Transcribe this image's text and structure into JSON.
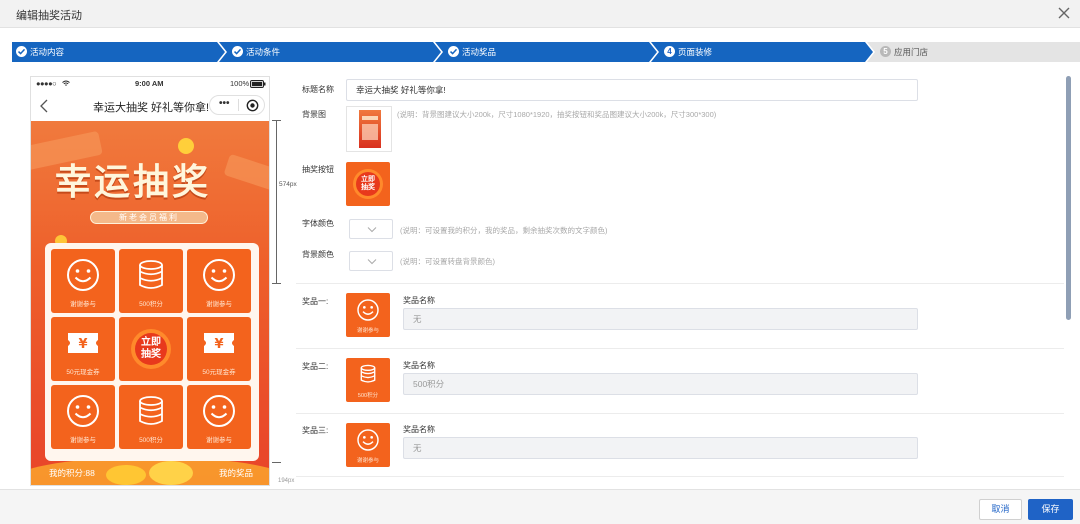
{
  "dialog": {
    "title": "编辑抽奖活动",
    "close_icon": "close-icon"
  },
  "steps": [
    {
      "label": "活动内容",
      "state": "done"
    },
    {
      "label": "活动条件",
      "state": "done"
    },
    {
      "label": "活动奖品",
      "state": "done"
    },
    {
      "label": "页面装修",
      "state": "current",
      "number": "4"
    },
    {
      "label": "应用门店",
      "state": "pending",
      "number": "5"
    }
  ],
  "colors": {
    "primary": "#1f63c6",
    "step_done": "#1565c0",
    "step_pending": "#e4e4e4",
    "prize_orange": "#f3631d",
    "hero_top": "#f07a3d",
    "hero_bottom": "#e8442a"
  },
  "phone": {
    "status": {
      "signal": "●●●●○",
      "time": "9:00 AM",
      "battery": "100%"
    },
    "nav_title": "幸运大抽奖 好礼等你拿!",
    "hero_title": "幸运抽奖",
    "hero_subtitle": "新老会员福利",
    "grid": [
      {
        "label": "谢谢参与",
        "icon": "smile-icon"
      },
      {
        "label": "500积分",
        "icon": "coin-stack-icon"
      },
      {
        "label": "谢谢参与",
        "icon": "smile-icon"
      },
      {
        "label": "50元现金券",
        "icon": "coupon-icon"
      },
      {
        "label": "立即抽奖",
        "icon": "draw-button"
      },
      {
        "label": "50元现金券",
        "icon": "coupon-icon"
      },
      {
        "label": "谢谢参与",
        "icon": "smile-icon"
      },
      {
        "label": "500积分",
        "icon": "coin-stack-icon"
      },
      {
        "label": "谢谢参与",
        "icon": "smile-icon"
      }
    ],
    "draw_button_text": "立即抽奖",
    "draw_button_line1": "立即",
    "draw_button_line2": "抽奖",
    "my_points": "我的积分:88",
    "my_prize": "我的奖品",
    "height_marker": "574px",
    "height_marker_2": "194px"
  },
  "form": {
    "title_label": "标题名称",
    "title_value": "幸运大抽奖 好礼等你拿!",
    "bg_label": "背景图",
    "bg_hint": "(说明：背景图建议大小200k，尺寸1080*1920，抽奖按钮和奖品图建议大小200k，尺寸300*300)",
    "draw_btn_label": "抽奖按钮",
    "draw_btn_thumb_line1": "立即",
    "draw_btn_thumb_line2": "抽奖",
    "font_color_label": "字体颜色",
    "font_color_hint": "(说明：可设置我的积分，我的奖品，剩余抽奖次数的文字颜色)",
    "bg_color_label": "背景颜色",
    "bg_color_hint": "(说明：可设置转盘背景颜色)",
    "prizes": [
      {
        "label": "奖品一:",
        "name_label": "奖品名称",
        "placeholder": "无",
        "thumb_caption": "谢谢参与",
        "icon": "smile-icon"
      },
      {
        "label": "奖品二:",
        "name_label": "奖品名称",
        "placeholder": "500积分",
        "thumb_caption": "500积分",
        "icon": "coin-stack-icon"
      },
      {
        "label": "奖品三:",
        "name_label": "奖品名称",
        "placeholder": "无",
        "thumb_caption": "谢谢参与",
        "icon": "smile-icon"
      }
    ]
  },
  "footer": {
    "cancel": "取消",
    "save": "保存"
  }
}
